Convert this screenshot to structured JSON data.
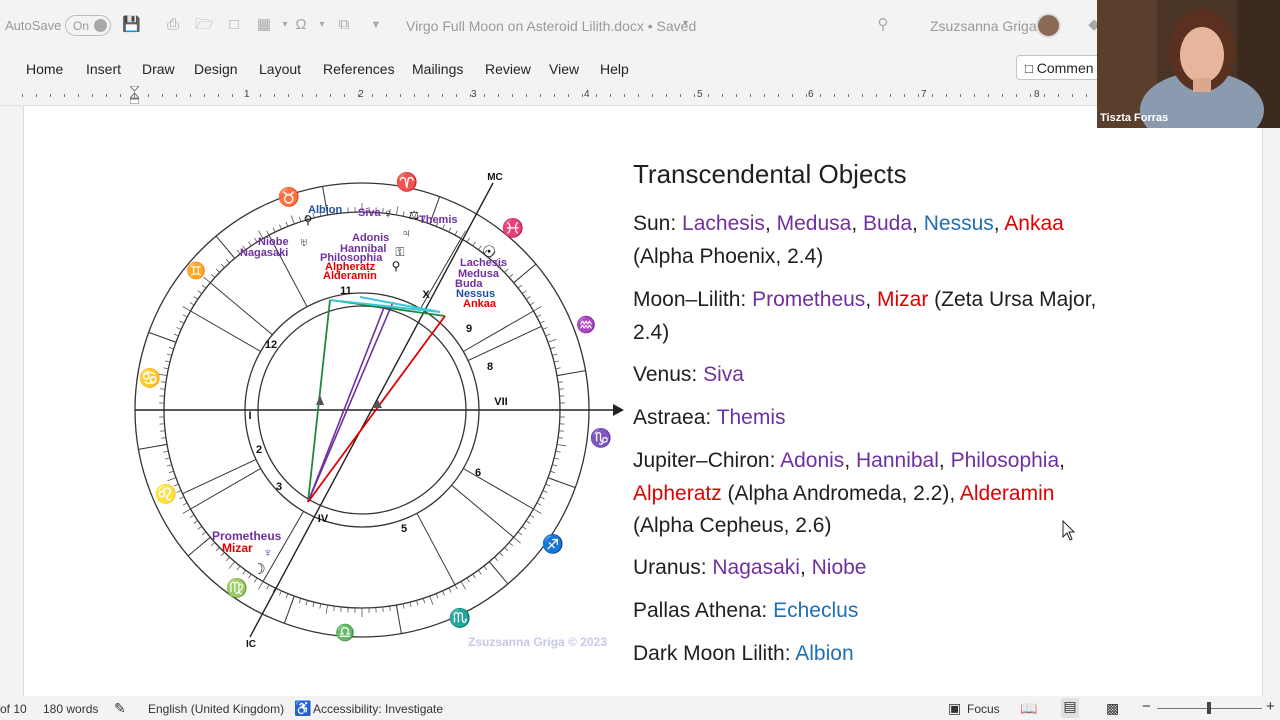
{
  "titlebar": {
    "autosave_label": "AutoSave",
    "autosave_state": "On",
    "document_title": "Virgo Full Moon on Asteroid Lilith.docx • Saved",
    "user_name": "Zsuzsanna Griga"
  },
  "ribbon": {
    "tabs": [
      "Home",
      "Insert",
      "Draw",
      "Design",
      "Layout",
      "References",
      "Mailings",
      "Review",
      "View",
      "Help"
    ],
    "comments_label": "Commen"
  },
  "ruler": {
    "numbers": [
      "1",
      "2",
      "3",
      "4",
      "5",
      "6",
      "7",
      "8"
    ]
  },
  "chart": {
    "angles": {
      "mc": "MC",
      "ic": "IC"
    },
    "houses": [
      "11",
      "12",
      "I",
      "2",
      "3",
      "IV",
      "5",
      "6",
      "VII",
      "8",
      "9",
      "X"
    ],
    "labels": {
      "albion": "Albion",
      "siva": "Siva",
      "themis": "Themis",
      "adonis": "Adonis",
      "hannibal": "Hannibal",
      "philosophia": "Philosophia",
      "alpheratz": "Alpheratz",
      "alderamin": "Alderamin",
      "niobe": "Niobe",
      "nagasaki": "Nagasaki",
      "lachesis": "Lachesis",
      "medusa": "Medusa",
      "buda": "Buda",
      "nessus": "Nessus",
      "ankaa": "Ankaa",
      "prometheus": "Prometheus",
      "mizar": "Mizar"
    },
    "copyright": "Zsuzsanna Griga © 2023",
    "colors": {
      "purple": "#7030a0",
      "red": "#e00000",
      "blue": "#1f4fa0",
      "green": "#1f8a3a",
      "cyan": "#3cc8d8"
    }
  },
  "content": {
    "heading": "Transcendental Objects",
    "sun_label": "Sun: ",
    "sun_lachesis": "Lachesis",
    "sun_medusa": "Medusa",
    "sun_buda": "Buda",
    "sun_nessus": "Nessus",
    "sun_ankaa": "Ankaa",
    "sun_note": "(Alpha Phoenix, 2.4)",
    "moon_label": "Moon–Lilith: ",
    "moon_prometheus": "Prometheus",
    "moon_mizar": "Mizar",
    "moon_note1": " (Zeta Ursa Major,",
    "moon_note2": "2.4)",
    "venus_label": "Venus: ",
    "venus_siva": "Siva",
    "astraea_label": "Astraea: ",
    "astraea_themis": "Themis",
    "jup_label": "Jupiter–Chiron: ",
    "jup_adonis": "Adonis",
    "jup_hannibal": "Hannibal",
    "jup_philosophia": "Philosophia",
    "jup_alpheratz": "Alpheratz",
    "jup_note1": " (Alpha Andromeda, 2.2), ",
    "jup_alderamin": "Alderamin",
    "jup_note2": "(Alpha Cepheus, 2.6)",
    "uranus_label": "Uranus: ",
    "uranus_nagasaki": "Nagasaki",
    "uranus_niobe": "Niobe",
    "pallas_label": "Pallas Athena: ",
    "pallas_echeclus": "Echeclus",
    "dml_label": "Dark Moon Lilith: ",
    "dml_albion": "Albion"
  },
  "status": {
    "page": "of 10",
    "words": "180 words",
    "language": "English (United Kingdom)",
    "accessibility": "Accessibility: Investigate",
    "focus": "Focus"
  },
  "webcam": {
    "name": "Tiszta Forras"
  }
}
